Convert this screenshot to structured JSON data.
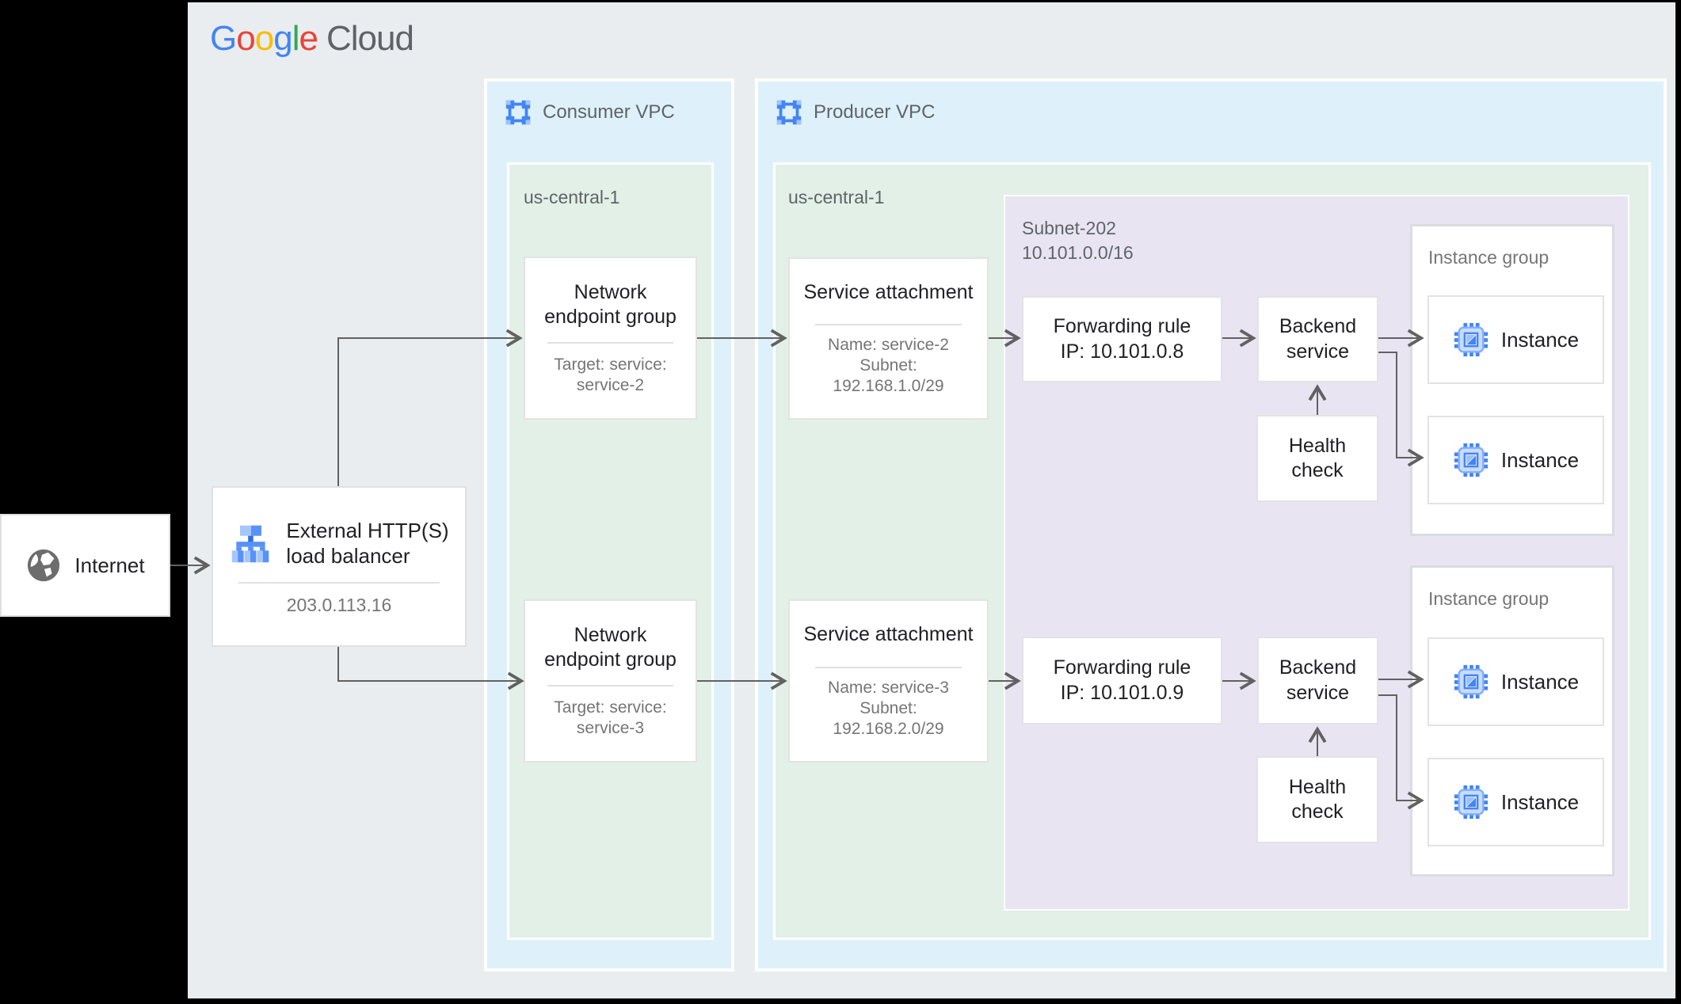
{
  "logo": {
    "letters": [
      {
        "ch": "G",
        "color": "#4285F4"
      },
      {
        "ch": "o",
        "color": "#EA4335"
      },
      {
        "ch": "o",
        "color": "#FBBC04"
      },
      {
        "ch": "g",
        "color": "#4285F4"
      },
      {
        "ch": "l",
        "color": "#34A853"
      },
      {
        "ch": "e",
        "color": "#EA4335"
      }
    ],
    "suffix": "Cloud"
  },
  "internet": {
    "label": "Internet"
  },
  "load_balancer": {
    "line1": "External HTTP(S)",
    "line2": "load balancer",
    "ip": "203.0.113.16"
  },
  "consumer_vpc": {
    "label": "Consumer VPC",
    "region_label": "us-central-1",
    "negs": [
      {
        "title_line1": "Network",
        "title_line2": "endpoint group",
        "target_line1": "Target: service:",
        "target_line2": "service-2"
      },
      {
        "title_line1": "Network",
        "title_line2": "endpoint group",
        "target_line1": "Target: service:",
        "target_line2": "service-3"
      }
    ]
  },
  "producer_vpc": {
    "label": "Producer VPC",
    "region_label": "us-central-1",
    "service_attachments": [
      {
        "title": "Service attachment",
        "name": "Name: service-2",
        "subnet_label": "Subnet:",
        "subnet_cidr": "192.168.1.0/29"
      },
      {
        "title": "Service attachment",
        "name": "Name: service-3",
        "subnet_label": "Subnet:",
        "subnet_cidr": "192.168.2.0/29"
      }
    ],
    "subnet": {
      "name": "Subnet-202",
      "cidr": "10.101.0.0/16",
      "forwarding_rules": [
        {
          "line1": "Forwarding rule",
          "line2": "IP: 10.101.0.8"
        },
        {
          "line1": "Forwarding rule",
          "line2": "IP: 10.101.0.9"
        }
      ],
      "backend_service": {
        "line1": "Backend",
        "line2": "service"
      },
      "health_check": {
        "line1": "Health",
        "line2": "check"
      }
    },
    "instance_groups": [
      {
        "label": "Instance group",
        "instances": [
          "Instance",
          "Instance"
        ]
      },
      {
        "label": "Instance group",
        "instances": [
          "Instance",
          "Instance"
        ]
      }
    ]
  },
  "icons": {
    "internet": "globe-icon",
    "load_balancer": "load-balancer-icon",
    "vpc": "vpc-network-icon",
    "instance": "compute-instance-icon"
  },
  "colors": {
    "canvas_bg": "#e9edf0",
    "frame_bg": "#000000",
    "vpc_bg": "#def0fa",
    "region_bg": "#e2f0e7",
    "subnet_bg": "#e9e4f2",
    "line": "#616161",
    "title_text": "#202124",
    "muted_text": "#757575",
    "zone_text": "#5f6368",
    "google_blue": "#4285F4"
  }
}
